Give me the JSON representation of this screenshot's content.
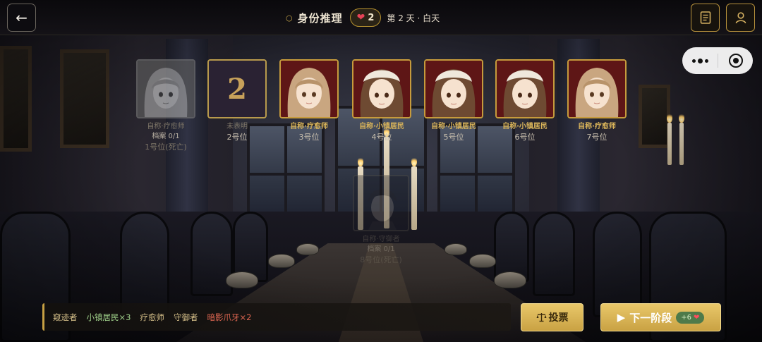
{
  "header": {
    "back_icon": "arrow-left-icon",
    "title": "身份推理",
    "hearts": "2",
    "day_info": "第 2 天 · 白天",
    "notes_icon": "notebook-icon",
    "profile_icon": "user-icon"
  },
  "capsule": {
    "menu_icon": "more-dots-icon",
    "close_icon": "target-circle-icon"
  },
  "players": [
    {
      "claim": "自称·疗愈师",
      "record": "档案 0/1",
      "seat": "1号位(死亡)",
      "state": "dead"
    },
    {
      "number": "2",
      "claim": "未表明",
      "seat": "2号位",
      "state": "self"
    },
    {
      "claim": "自称·疗愈师",
      "seat": "3号位",
      "state": "alive"
    },
    {
      "claim": "自称·小镇居民",
      "seat": "4号位",
      "state": "alive"
    },
    {
      "claim": "自称·小镇居民",
      "seat": "5号位",
      "state": "alive"
    },
    {
      "claim": "自称·小镇居民",
      "seat": "6号位",
      "state": "alive"
    },
    {
      "claim": "自称·疗愈师",
      "seat": "7号位",
      "state": "alive"
    }
  ],
  "ghost_player": {
    "claim": "自称·守御者",
    "record": "档案 0/1",
    "seat": "8号位(死亡)"
  },
  "roles": [
    {
      "label": "窥迹者",
      "team": "neutral"
    },
    {
      "label": "小镇居民×3",
      "team": "good"
    },
    {
      "label": "疗愈师",
      "team": "neutral"
    },
    {
      "label": "守御者",
      "team": "neutral"
    },
    {
      "label": "暗影爪牙×2",
      "team": "evil"
    }
  ],
  "actions": {
    "vote_label": "投票",
    "vote_icon": "scales-icon",
    "next_label": "下一阶段",
    "next_icon": "play-icon",
    "reward": "+6",
    "reward_icon": "heart-icon"
  },
  "colors": {
    "gold": "#c69b3c",
    "good": "#9fd08a",
    "evil": "#e06752",
    "heart": "#e64358"
  }
}
